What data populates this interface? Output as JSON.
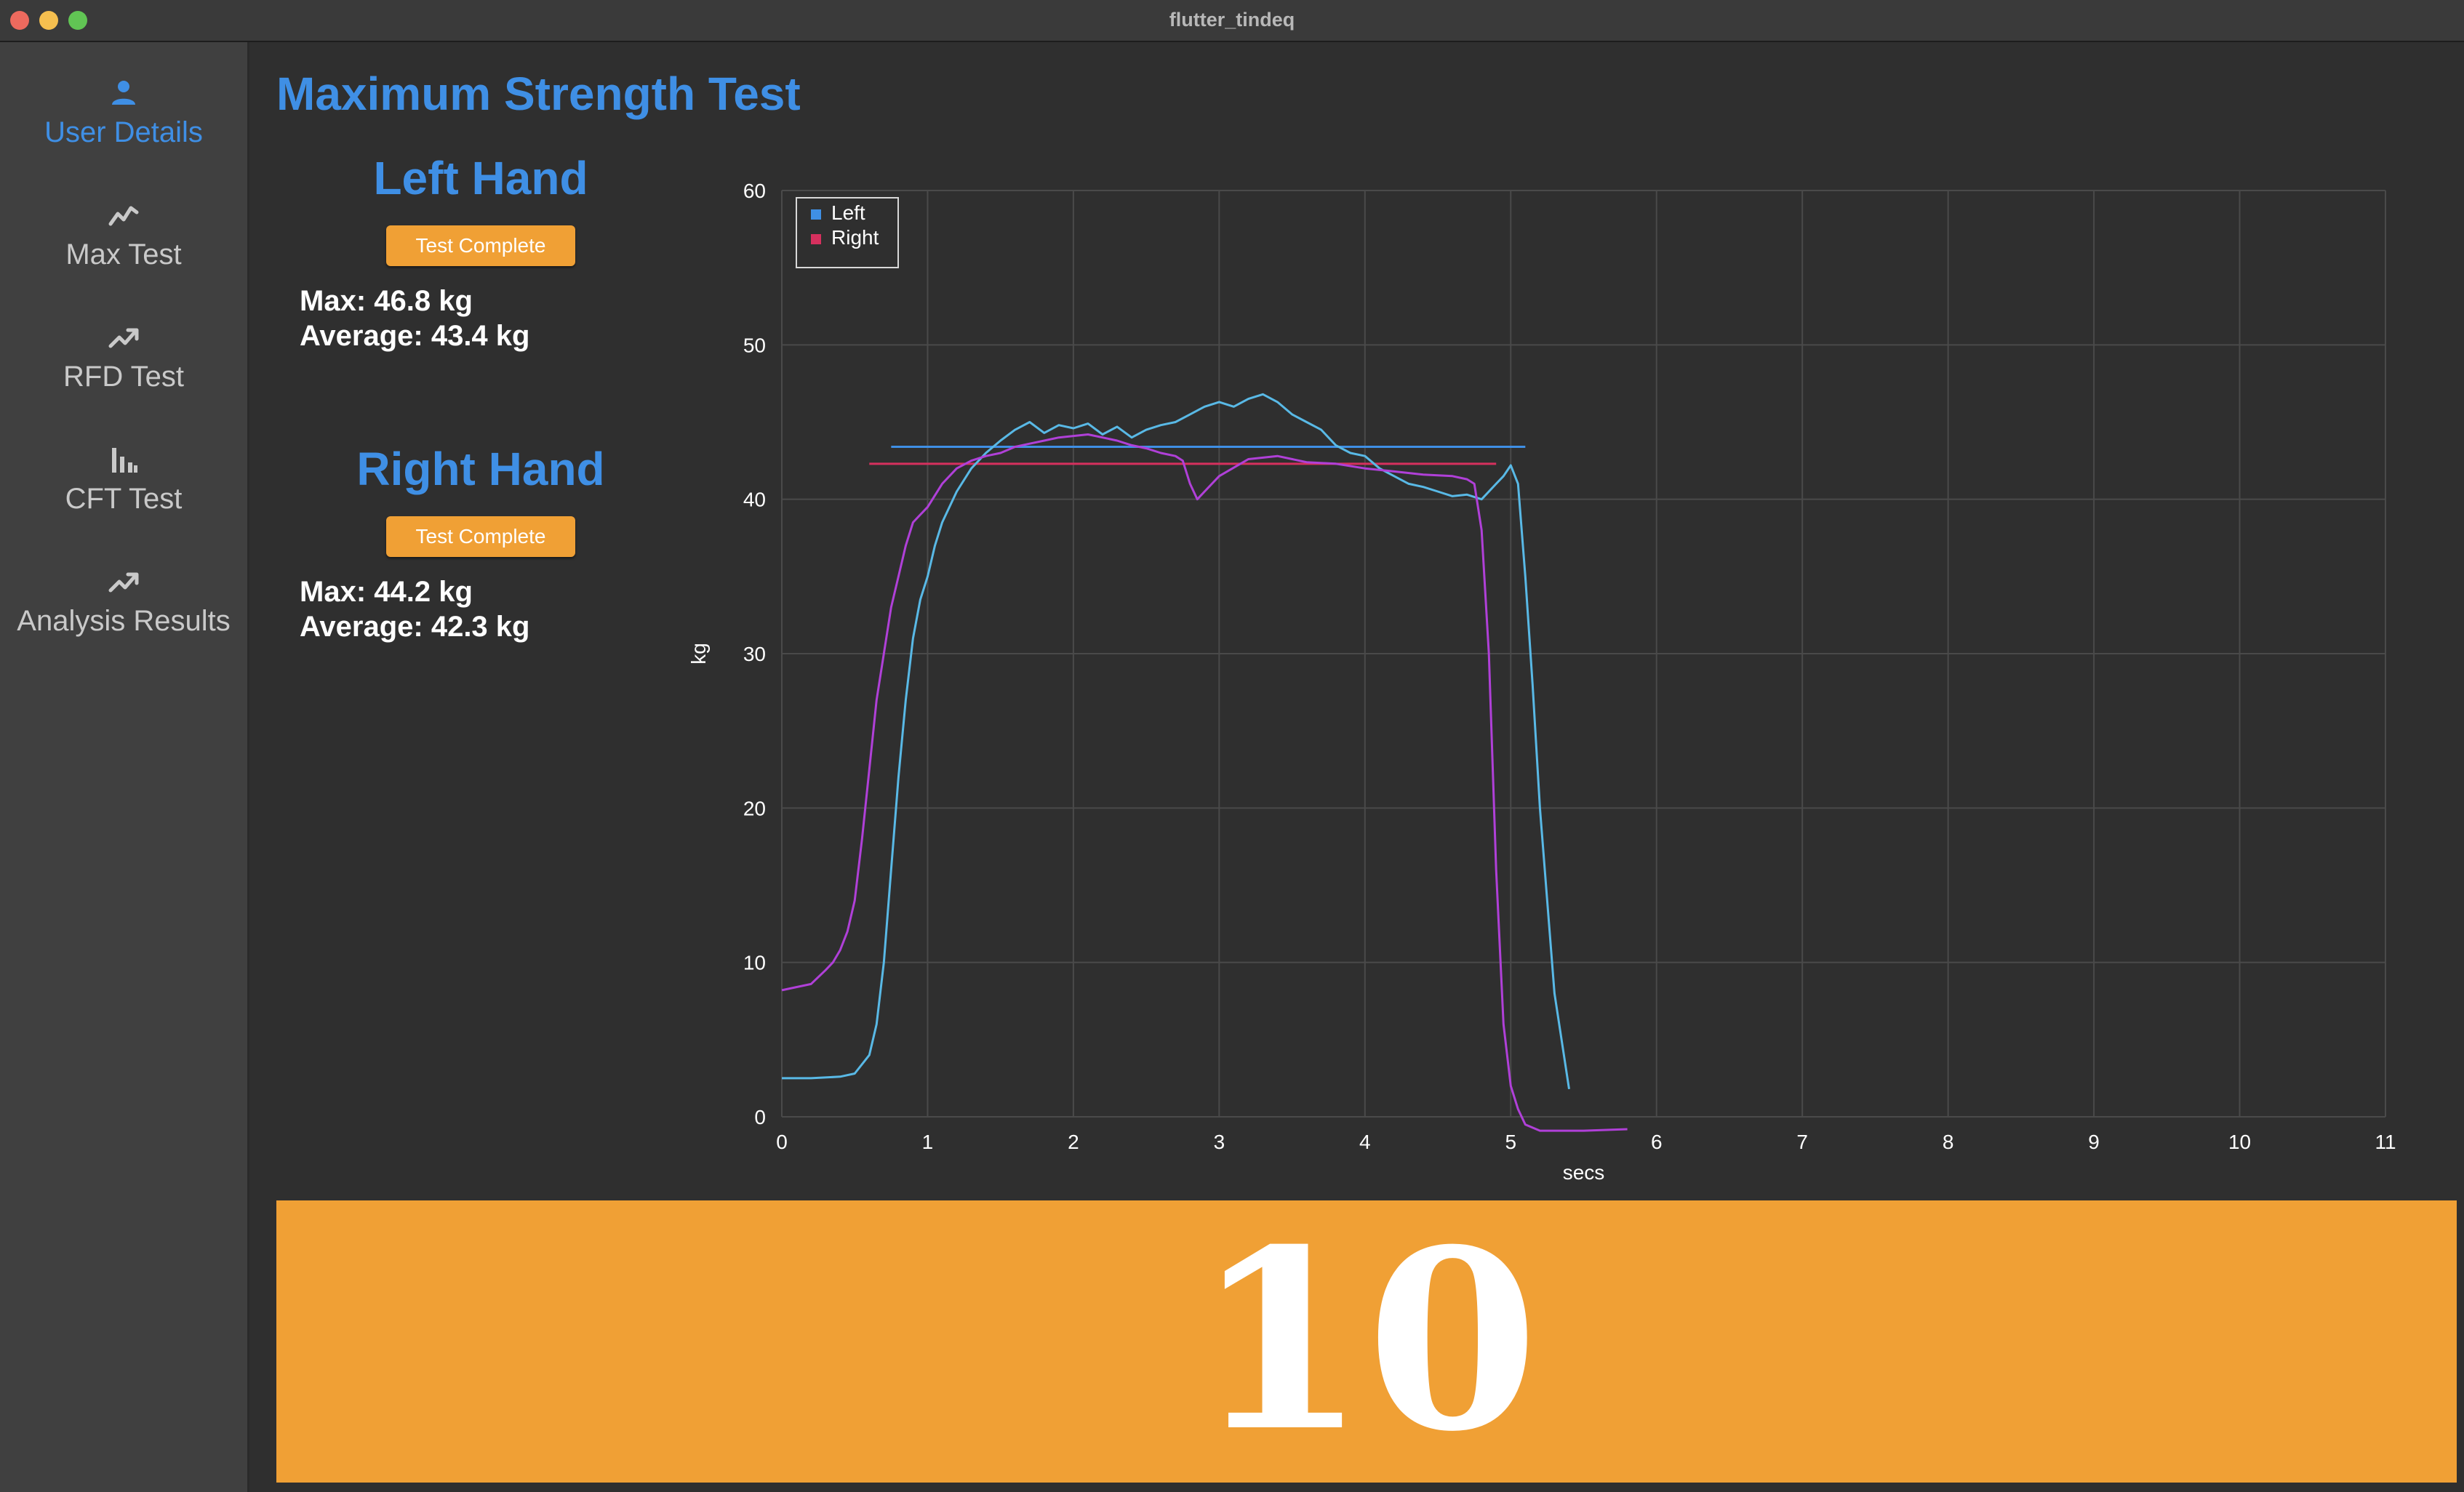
{
  "window": {
    "title": "flutter_tindeq"
  },
  "sidebar": {
    "items": [
      {
        "label": "User Details",
        "icon": "person-icon",
        "active": true
      },
      {
        "label": "Max Test",
        "icon": "line-chart-icon",
        "active": false
      },
      {
        "label": "RFD Test",
        "icon": "trending-up-icon",
        "active": false
      },
      {
        "label": "CFT Test",
        "icon": "bar-chart-icon",
        "active": false
      },
      {
        "label": "Analysis Results",
        "icon": "trending-up-icon",
        "active": false
      }
    ]
  },
  "main": {
    "title": "Maximum Strength Test",
    "left_hand": {
      "title": "Left Hand",
      "status": "Test Complete",
      "max": "Max: 46.8 kg",
      "average": "Average: 43.4 kg"
    },
    "right_hand": {
      "title": "Right Hand",
      "status": "Test Complete",
      "max": "Max: 44.2 kg",
      "average": "Average: 42.3 kg"
    }
  },
  "countdown": {
    "value": "10"
  },
  "colors": {
    "accent": "#3f8fe5",
    "button": "#f0a035",
    "left_series": "#59b9e6",
    "right_series": "#b040d8",
    "left_average": "#3f8fe5",
    "right_average": "#d6305e"
  },
  "chart_data": {
    "type": "line",
    "xlabel": "secs",
    "ylabel": "kg",
    "xlim": [
      0,
      11
    ],
    "ylim": [
      0,
      60
    ],
    "xticks": [
      0,
      1,
      2,
      3,
      4,
      5,
      6,
      7,
      8,
      9,
      10,
      11
    ],
    "yticks": [
      0,
      10,
      20,
      30,
      40,
      50,
      60
    ],
    "grid": true,
    "legend": {
      "position": "top-left",
      "entries": [
        "Left",
        "Right"
      ]
    },
    "series": [
      {
        "name": "Left",
        "x": [
          0,
          0.2,
          0.4,
          0.5,
          0.6,
          0.65,
          0.7,
          0.75,
          0.8,
          0.85,
          0.9,
          0.95,
          1.0,
          1.05,
          1.1,
          1.2,
          1.3,
          1.4,
          1.5,
          1.6,
          1.7,
          1.8,
          1.9,
          2.0,
          2.1,
          2.2,
          2.3,
          2.4,
          2.5,
          2.6,
          2.7,
          2.8,
          2.9,
          3.0,
          3.1,
          3.2,
          3.3,
          3.4,
          3.5,
          3.6,
          3.7,
          3.8,
          3.9,
          4.0,
          4.1,
          4.2,
          4.3,
          4.4,
          4.5,
          4.6,
          4.7,
          4.8,
          4.9,
          4.95,
          5.0,
          5.05,
          5.1,
          5.15,
          5.2,
          5.3,
          5.4
        ],
        "y": [
          2.5,
          2.5,
          2.6,
          2.8,
          4.0,
          6.0,
          10.0,
          16.0,
          22.0,
          27.0,
          31.0,
          33.5,
          35.0,
          37.0,
          38.5,
          40.5,
          42.0,
          43.0,
          43.8,
          44.5,
          45.0,
          44.3,
          44.8,
          44.6,
          44.9,
          44.2,
          44.7,
          44.0,
          44.5,
          44.8,
          45.0,
          45.5,
          46.0,
          46.3,
          46.0,
          46.5,
          46.8,
          46.3,
          45.5,
          45.0,
          44.5,
          43.5,
          43.0,
          42.8,
          42.0,
          41.5,
          41.0,
          40.8,
          40.5,
          40.2,
          40.3,
          40.0,
          41.0,
          41.5,
          42.2,
          41.0,
          35.0,
          28.0,
          20.0,
          8.0,
          1.8
        ]
      },
      {
        "name": "Right",
        "x": [
          0,
          0.1,
          0.2,
          0.3,
          0.35,
          0.4,
          0.45,
          0.5,
          0.55,
          0.6,
          0.65,
          0.7,
          0.75,
          0.8,
          0.85,
          0.9,
          0.95,
          1.0,
          1.1,
          1.2,
          1.3,
          1.4,
          1.5,
          1.6,
          1.7,
          1.8,
          1.9,
          2.0,
          2.1,
          2.2,
          2.3,
          2.4,
          2.5,
          2.6,
          2.7,
          2.75,
          2.8,
          2.85,
          2.9,
          3.0,
          3.2,
          3.4,
          3.6,
          3.8,
          4.0,
          4.2,
          4.4,
          4.6,
          4.7,
          4.75,
          4.8,
          4.85,
          4.9,
          4.95,
          5.0,
          5.05,
          5.1,
          5.2,
          5.3,
          5.5,
          5.8
        ],
        "y": [
          8.2,
          8.4,
          8.6,
          9.5,
          10.0,
          10.8,
          12.0,
          14.0,
          18.0,
          22.5,
          27.0,
          30.0,
          33.0,
          35.0,
          37.0,
          38.5,
          39.0,
          39.5,
          41.0,
          42.0,
          42.5,
          42.8,
          43.0,
          43.4,
          43.6,
          43.8,
          44.0,
          44.1,
          44.2,
          44.0,
          43.8,
          43.5,
          43.3,
          43.0,
          42.8,
          42.5,
          41.0,
          40.0,
          40.5,
          41.5,
          42.6,
          42.8,
          42.4,
          42.3,
          42.0,
          41.8,
          41.6,
          41.5,
          41.3,
          41.0,
          38.0,
          30.0,
          16.0,
          6.0,
          2.0,
          0.5,
          -0.5,
          -0.9,
          -0.9,
          -0.9,
          -0.8
        ]
      }
    ],
    "averages": [
      {
        "series": "Left",
        "value": 43.4,
        "x_start": 0.75,
        "x_end": 5.1
      },
      {
        "series": "Right",
        "value": 42.3,
        "x_start": 0.6,
        "x_end": 4.9
      }
    ]
  }
}
